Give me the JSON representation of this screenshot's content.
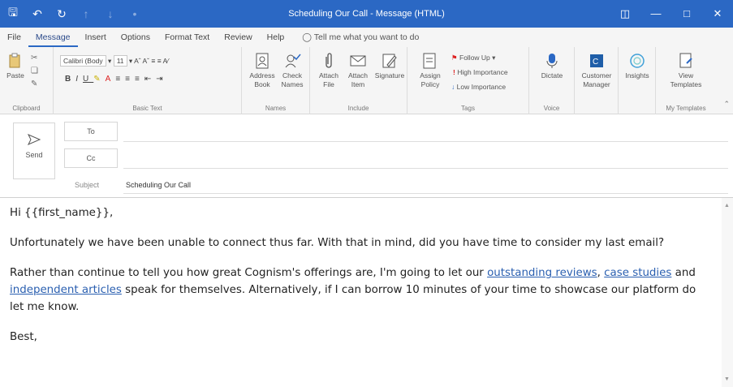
{
  "window": {
    "title": "Scheduling Our Call  -  Message (HTML)"
  },
  "tabs": [
    "File",
    "Message",
    "Insert",
    "Options",
    "Format Text",
    "Review",
    "Help"
  ],
  "tell_me": "Tell me what you want to do",
  "ribbon": {
    "clipboard": {
      "paste": "Paste",
      "label": "Clipboard"
    },
    "basic_text": {
      "font": "Calibri (Body",
      "size": "11",
      "label": "Basic Text"
    },
    "names": {
      "address_book": "Address\nBook",
      "check_names": "Check\nNames",
      "label": "Names"
    },
    "include": {
      "attach_file": "Attach\nFile",
      "attach_item": "Attach\nItem",
      "signature": "Signature",
      "label": "Include"
    },
    "tags": {
      "assign_policy": "Assign\nPolicy",
      "follow_up": "Follow Up",
      "high_importance": "High Importance",
      "low_importance": "Low Importance",
      "label": "Tags"
    },
    "voice": {
      "dictate": "Dictate",
      "label": "Voice"
    },
    "customer_manager": "Customer\nManager",
    "insights": "Insights",
    "my_templates": {
      "view_templates": "View\nTemplates",
      "label": "My Templates"
    }
  },
  "compose": {
    "send": "Send",
    "to": "To",
    "cc": "Cc",
    "subject_label": "Subject",
    "subject_value": "Scheduling Our Call"
  },
  "email_body": {
    "greeting": "Hi {{first_name}},",
    "para1": "Unfortunately we have been unable to connect thus far. With that in mind, did you have time to consider my last email?",
    "para2_a": "Rather than continue to tell you how great Cognism's offerings are, I'm going to let our ",
    "link1": "outstanding reviews",
    "para2_b": ", ",
    "link2": "case studies",
    "para2_c": " and ",
    "link3": "independent articles",
    "para2_d": " speak for themselves. Alternatively, if I can borrow 10 minutes of your time to showcase our platform do let me know.",
    "closing": "Best,"
  },
  "colors": {
    "titlebar": "#2b68c4",
    "link": "#2a5fb0"
  }
}
